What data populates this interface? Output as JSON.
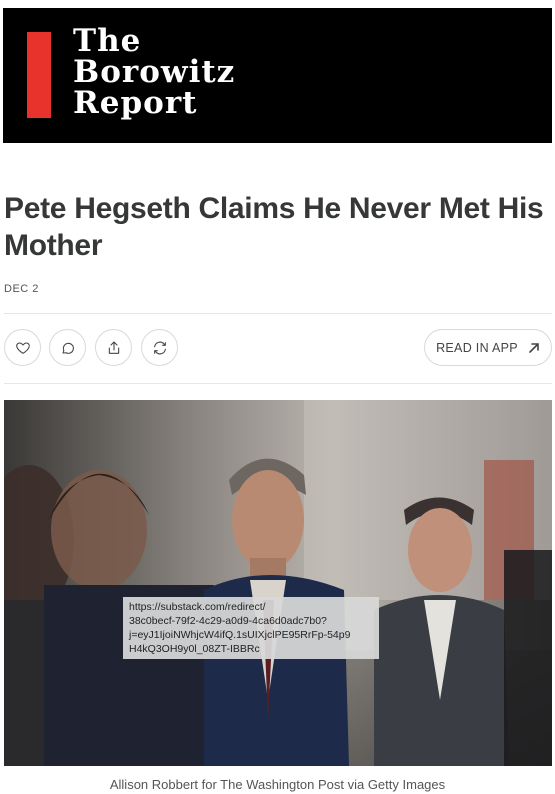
{
  "banner": {
    "title_lines": [
      "The",
      "Borowitz",
      "Report"
    ],
    "accent_color": "#e8332c"
  },
  "article": {
    "title": "Pete Hegseth Claims He Never Met His Mother",
    "date": "DEC 2"
  },
  "actions": {
    "like_icon": "heart-icon",
    "comment_icon": "comment-icon",
    "share_icon": "share-icon",
    "restack_icon": "restack-icon",
    "read_in_app_label": "READ IN APP"
  },
  "link_tooltip": {
    "line1": "https://substack.com/redirect/",
    "line2": "38c0becf-79f2-4c29-a0d9-4ca6d0adc7b0?",
    "line3": "j=eyJ1IjoiNWhjcW4ifQ.1sUIXjclPE95RrFp-54p9",
    "line4": "H4kQ3OH9y0l_08ZT-IBBRc"
  },
  "image": {
    "caption": "Allison Robbert for The Washington Post via Getty Images"
  }
}
